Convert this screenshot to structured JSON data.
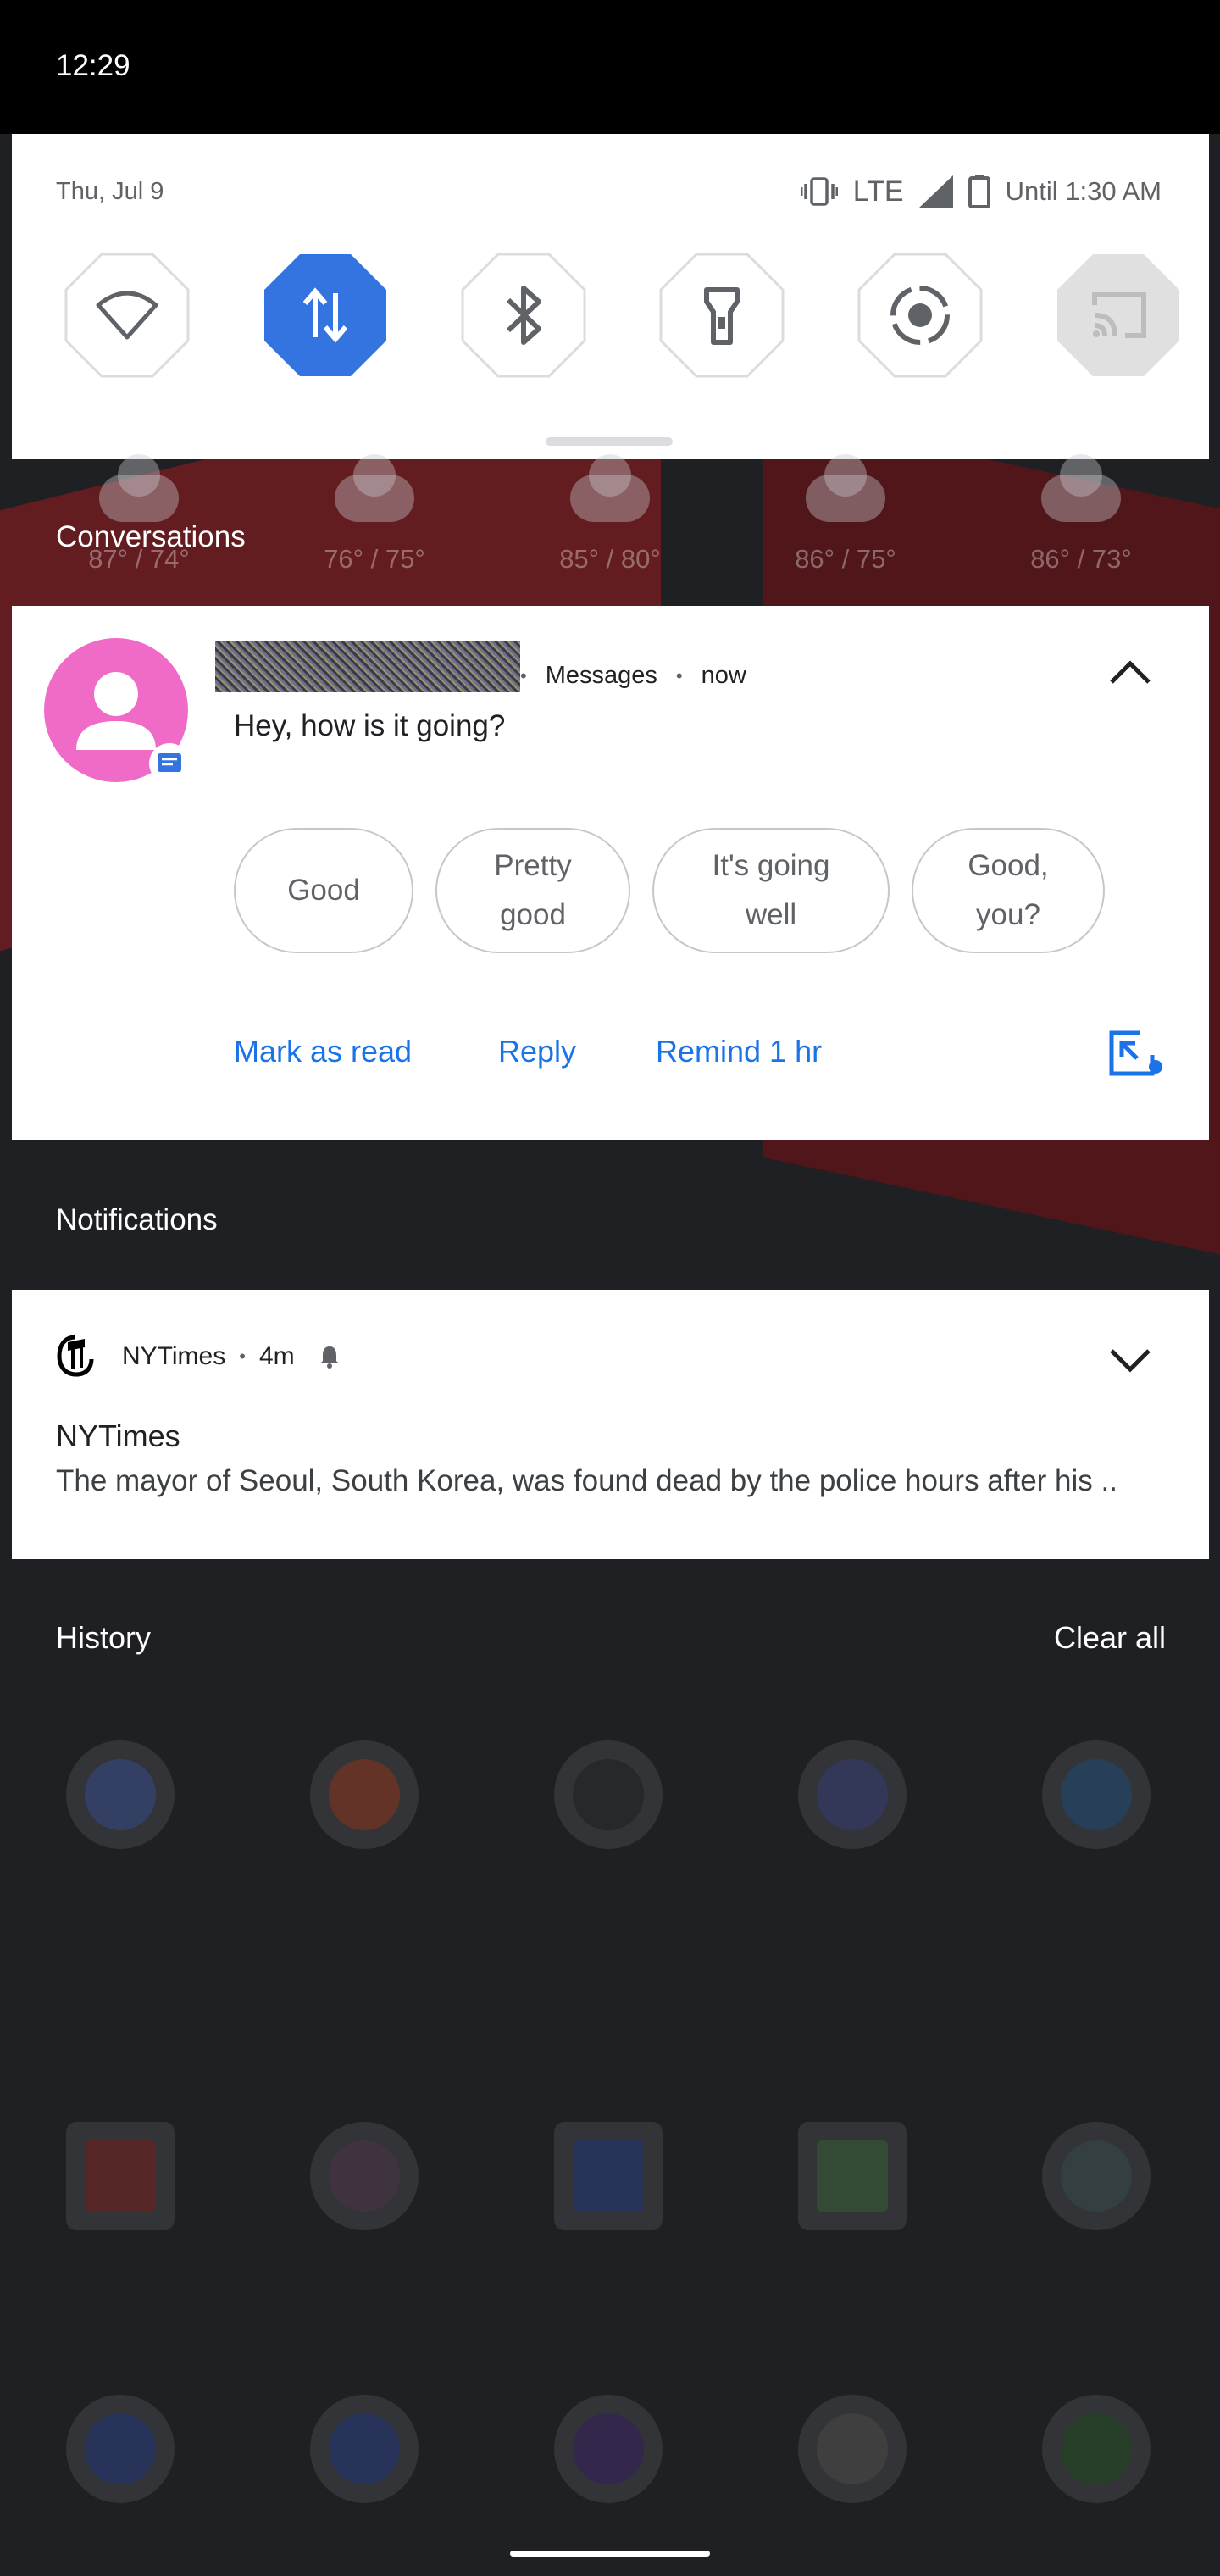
{
  "status_bar": {
    "time": "12:29"
  },
  "quick_settings": {
    "date": "Thu, Jul 9",
    "network": "LTE",
    "battery_text": "Until 1:30 AM",
    "tiles": [
      {
        "name": "wifi-icon",
        "active": false
      },
      {
        "name": "mobile-data-icon",
        "active": true
      },
      {
        "name": "bluetooth-icon",
        "active": false
      },
      {
        "name": "flashlight-icon",
        "active": false
      },
      {
        "name": "auto-rotate-icon",
        "active": false
      },
      {
        "name": "cast-icon",
        "active": false
      }
    ],
    "accent_color": "#3474e0"
  },
  "weather": [
    {
      "temp": "87° / 74°"
    },
    {
      "temp": "76° / 75°"
    },
    {
      "temp": "85° / 80°"
    },
    {
      "temp": "86° / 75°"
    },
    {
      "temp": "86° / 73°"
    }
  ],
  "conversations": {
    "section_title": "Conversations",
    "card": {
      "app": "Messages",
      "time": "now",
      "message": "Hey, how is it going?",
      "smart_replies": [
        "Good",
        "Pretty good",
        "It's going well",
        "Good, you?"
      ],
      "actions": [
        "Mark as read",
        "Reply",
        "Remind 1 hr"
      ]
    }
  },
  "notifications": {
    "section_title": "Notifications",
    "nytimes": {
      "app": "NYTimes",
      "time": "4m",
      "title": "NYTimes",
      "body": "The mayor of Seoul, South Korea, was found dead by the police hours after his .."
    }
  },
  "history": {
    "title": "History",
    "clear_label": "Clear all"
  }
}
